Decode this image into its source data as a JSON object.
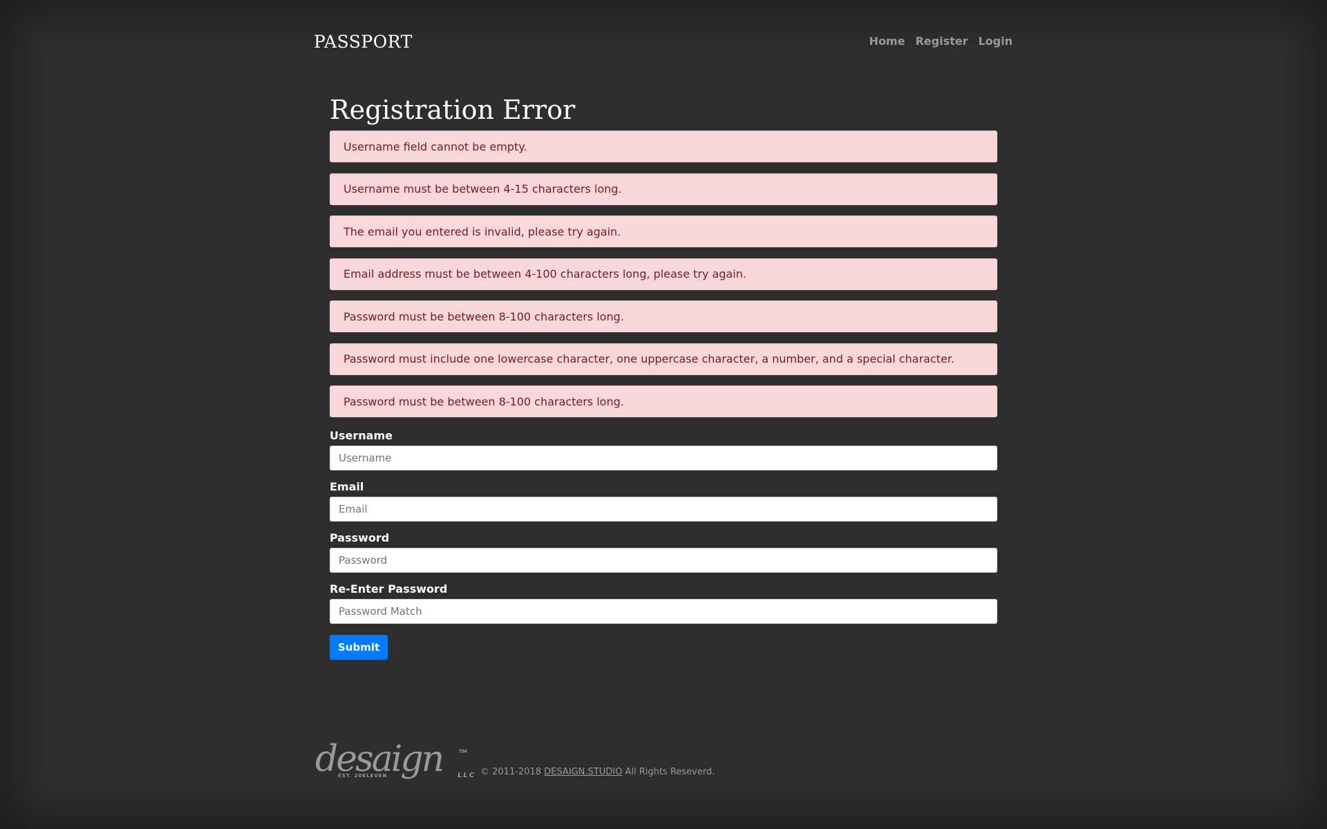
{
  "navbar": {
    "brand": "PASSPORT",
    "links": [
      "Home",
      "Register",
      "Login"
    ]
  },
  "page": {
    "title": "Registration Error"
  },
  "alerts": [
    "Username field cannot be empty.",
    "Username must be between 4-15 characters long.",
    "The email you entered is invalid, please try again.",
    "Email address must be between 4-100 characters long, please try again.",
    "Password must be between 8-100 characters long.",
    "Password must include one lowercase character, one uppercase character, a number, and a special character.",
    "Password must be between 8-100 characters long."
  ],
  "form": {
    "fields": [
      {
        "label": "Username",
        "placeholder": "Username",
        "value": ""
      },
      {
        "label": "Email",
        "placeholder": "Email",
        "value": ""
      },
      {
        "label": "Password",
        "placeholder": "Password",
        "value": ""
      },
      {
        "label": "Re-Enter Password",
        "placeholder": "Password Match",
        "value": ""
      }
    ],
    "submit_label": "Submit"
  },
  "footer": {
    "logo_text": "desaign",
    "logo_tagline": "EST. 20ELEVEN",
    "logo_suffix": "LLC",
    "logo_tm": "TM",
    "copyright_prefix": "© 2011-2018",
    "link_text": "DESAIGN.STUDIO",
    "copyright_suffix": "All Rights Reseverd."
  },
  "colors": {
    "background": "#2e2e2e",
    "alert_bg": "#f8d7da",
    "alert_text": "#721c24",
    "primary": "#007bff",
    "muted": "#9a9a9a"
  }
}
